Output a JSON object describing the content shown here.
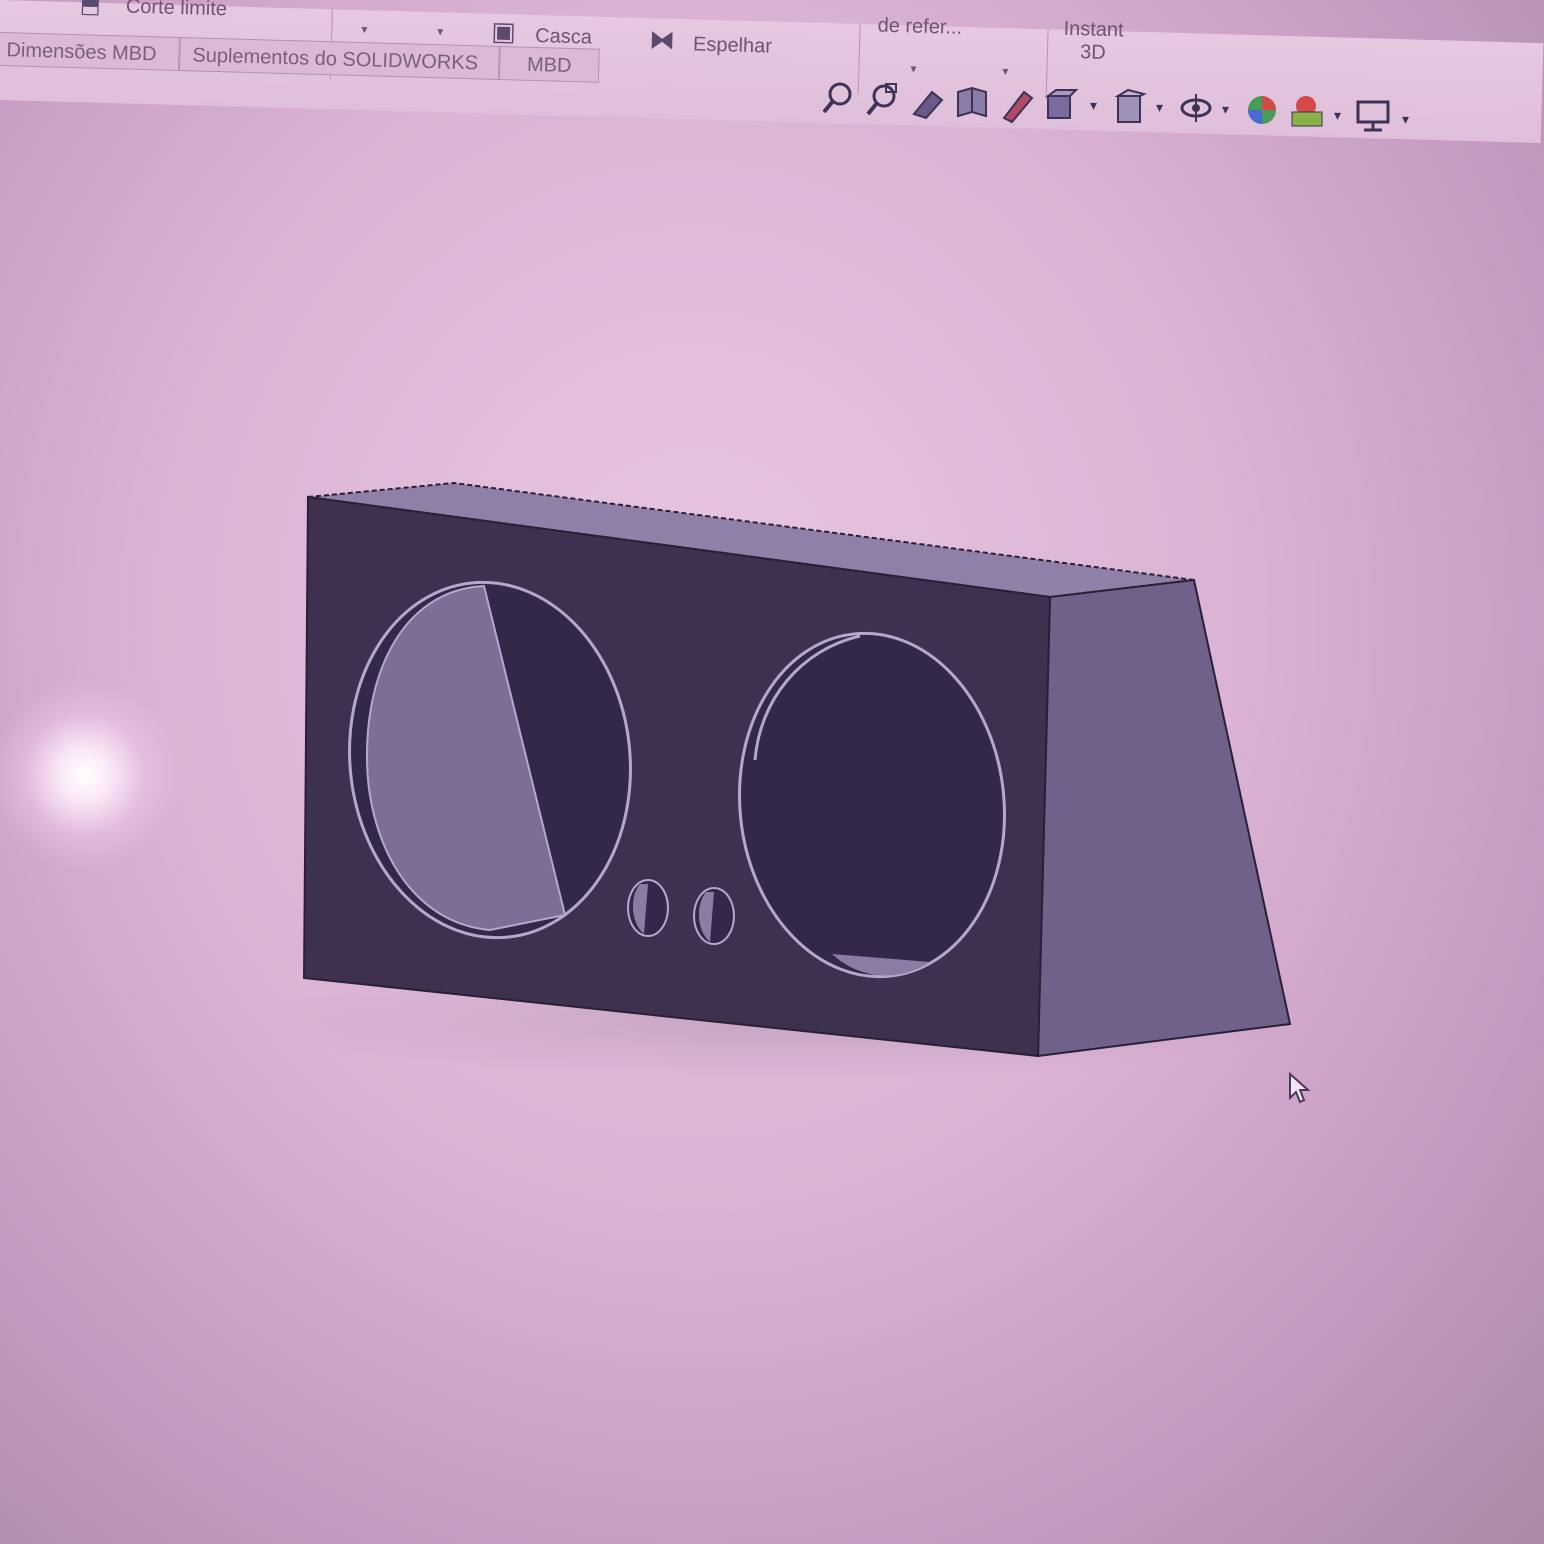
{
  "ribbon": {
    "corte_limite": "Corte limite",
    "casca": "Casca",
    "espelhar": "Espelhar",
    "geometria_ref": "de refer...",
    "instant3d_line1": "Instant",
    "instant3d_line2": "3D"
  },
  "tabs": [
    {
      "label": "Dimensões MBD"
    },
    {
      "label": "Suplementos do SOLIDWORKS"
    },
    {
      "label": "MBD"
    }
  ],
  "view_toolbar": {
    "icons": [
      "zoom-to-fit-icon",
      "zoom-to-area-icon",
      "previous-view-icon",
      "section-view-icon",
      "dynamic-annotation-icon",
      "view-orientation-icon",
      "display-style-icon",
      "hide-show-items-icon",
      "edit-appearance-icon",
      "apply-scene-icon",
      "view-settings-icon"
    ]
  },
  "model": {
    "name": "subwoofer-box",
    "speaker_cutouts": 2,
    "port_holes": 2
  },
  "colors": {
    "front_face": "#3e3150",
    "side_face": "#6f6189",
    "top_face": "#8f80a8",
    "edge": "#2a2036"
  }
}
